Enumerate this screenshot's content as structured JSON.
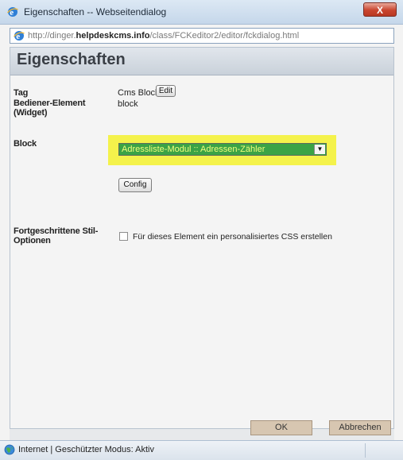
{
  "window": {
    "title": "Eigenschaften -- Webseitendialog",
    "close_glyph": "X"
  },
  "address": {
    "prefix": "http://dinger.",
    "host": "helpdeskcms.info",
    "path": "/class/FCKeditor2/editor/fckdialog.html"
  },
  "dialog": {
    "heading": "Eigenschaften",
    "tag_label": "Tag",
    "tag_value": "Cms Block",
    "edit_button": "Edit",
    "widget_label_line1": "Bediener-Element",
    "widget_label_line2": "(Widget)",
    "widget_value": "block",
    "block_label": "Block",
    "block_select_value": "Adressliste-Modul :: Adressen-Zähler",
    "config_button": "Config",
    "advanced_label_line1": "Fortgeschrittene Stil-",
    "advanced_label_line2": "Optionen",
    "custom_css_checkbox_label": "Für dieses Element ein personalisiertes CSS erstellen",
    "custom_css_checked": false
  },
  "buttons": {
    "ok": "OK",
    "cancel": "Abbrechen"
  },
  "status": {
    "text": "Internet | Geschützter Modus: Aktiv"
  },
  "colors": {
    "highlight": "#f4f24b",
    "select_bg": "#3aa346",
    "select_text": "#f2ff7a"
  }
}
